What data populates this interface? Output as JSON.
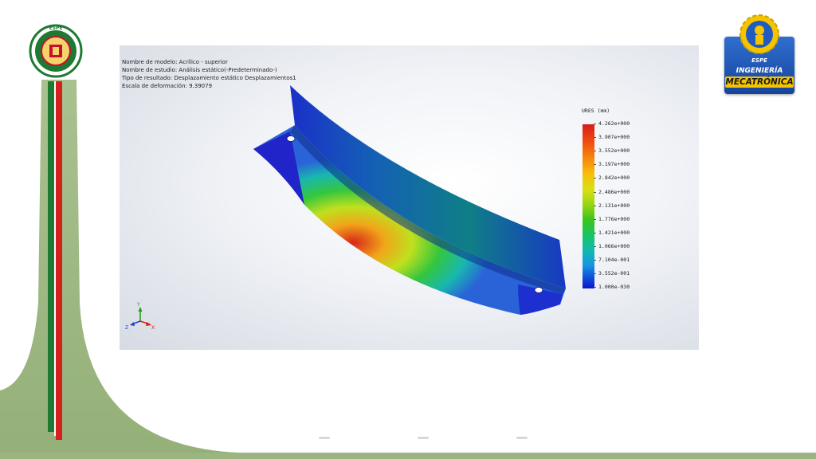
{
  "slide": {
    "colors": {
      "bg": "#ffffff",
      "green": "#9ab57f",
      "stripe_green": "#1e7a33",
      "stripe_red": "#d62020",
      "logo_blue": "#1f5bc0",
      "logo_yellow": "#f5c400"
    }
  },
  "left_logo": {
    "top_text": "ESPE",
    "ring_text": "UNIVERSIDAD DE LAS FUERZAS ARMADAS"
  },
  "right_logo": {
    "line1": "ESPE",
    "line2": "INGENIERÍA",
    "line3": "MECATRÓNICA"
  },
  "simulation": {
    "info": {
      "model_name": "Nombre de modelo: Acrílico - superior",
      "study_name": "Nombre de estudio: Análisis estático(-Predeterminado-)",
      "result_type": "Tipo de resultado: Desplazamiento estático Desplazamientos1",
      "deformation_scale": "Escala de deformación: 9.39079"
    },
    "legend": {
      "title": "URES (mm)",
      "labels": [
        "4.262e+000",
        "3.907e+000",
        "3.552e+000",
        "3.197e+000",
        "2.842e+000",
        "2.486e+000",
        "2.131e+000",
        "1.776e+000",
        "1.421e+000",
        "1.066e+000",
        "7.104e-001",
        "3.552e-001",
        "1.000e-030"
      ]
    },
    "triad": {
      "x": "X",
      "y": "Y",
      "z": "Z"
    }
  }
}
